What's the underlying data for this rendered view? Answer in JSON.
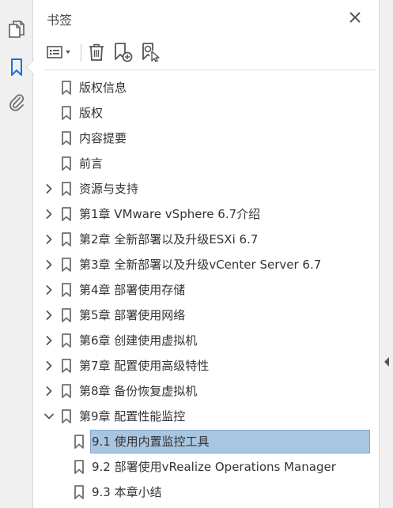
{
  "panel": {
    "title": "书签",
    "close_icon": "close-icon"
  },
  "rail": {
    "items": [
      {
        "name": "pages",
        "icon": "pages-icon"
      },
      {
        "name": "bookmarks",
        "icon": "bookmark-icon",
        "active": true
      },
      {
        "name": "attachments",
        "icon": "paperclip-icon"
      }
    ]
  },
  "toolbar": {
    "items": [
      {
        "name": "options",
        "icon": "list-options-icon"
      },
      {
        "name": "delete",
        "icon": "trash-icon"
      },
      {
        "name": "new-bookmark",
        "icon": "new-bookmark-icon"
      },
      {
        "name": "find-current",
        "icon": "find-bookmark-icon"
      }
    ]
  },
  "bookmarks": [
    {
      "label": "版权信息",
      "expandable": false,
      "level": 0
    },
    {
      "label": "版权",
      "expandable": false,
      "level": 0
    },
    {
      "label": "内容提要",
      "expandable": false,
      "level": 0
    },
    {
      "label": "前言",
      "expandable": false,
      "level": 0
    },
    {
      "label": "资源与支持",
      "expandable": true,
      "expanded": false,
      "level": 0
    },
    {
      "label": "第1章 VMware vSphere 6.7介绍",
      "expandable": true,
      "expanded": false,
      "level": 0
    },
    {
      "label": "第2章 全新部署以及升级ESXi 6.7",
      "expandable": true,
      "expanded": false,
      "level": 0
    },
    {
      "label": "第3章 全新部署以及升级vCenter Server 6.7",
      "expandable": true,
      "expanded": false,
      "level": 0
    },
    {
      "label": "第4章 部署使用存储",
      "expandable": true,
      "expanded": false,
      "level": 0
    },
    {
      "label": "第5章 部署使用网络",
      "expandable": true,
      "expanded": false,
      "level": 0
    },
    {
      "label": "第6章 创建使用虚拟机",
      "expandable": true,
      "expanded": false,
      "level": 0
    },
    {
      "label": "第7章 配置使用高级特性",
      "expandable": true,
      "expanded": false,
      "level": 0
    },
    {
      "label": "第8章 备份恢复虚拟机",
      "expandable": true,
      "expanded": false,
      "level": 0
    },
    {
      "label": "第9章 配置性能监控",
      "expandable": true,
      "expanded": true,
      "level": 0
    },
    {
      "label": "9.1 使用内置监控工具",
      "expandable": false,
      "level": 1,
      "selected": true
    },
    {
      "label": "9.2 部署使用vRealize Operations Manager",
      "expandable": false,
      "level": 1
    },
    {
      "label": "9.3 本章小结",
      "expandable": false,
      "level": 1
    }
  ],
  "colors": {
    "selected_bg": "#a9c6e0",
    "accent_blue": "#1473e6",
    "icon_gray": "#6e6e6e"
  }
}
